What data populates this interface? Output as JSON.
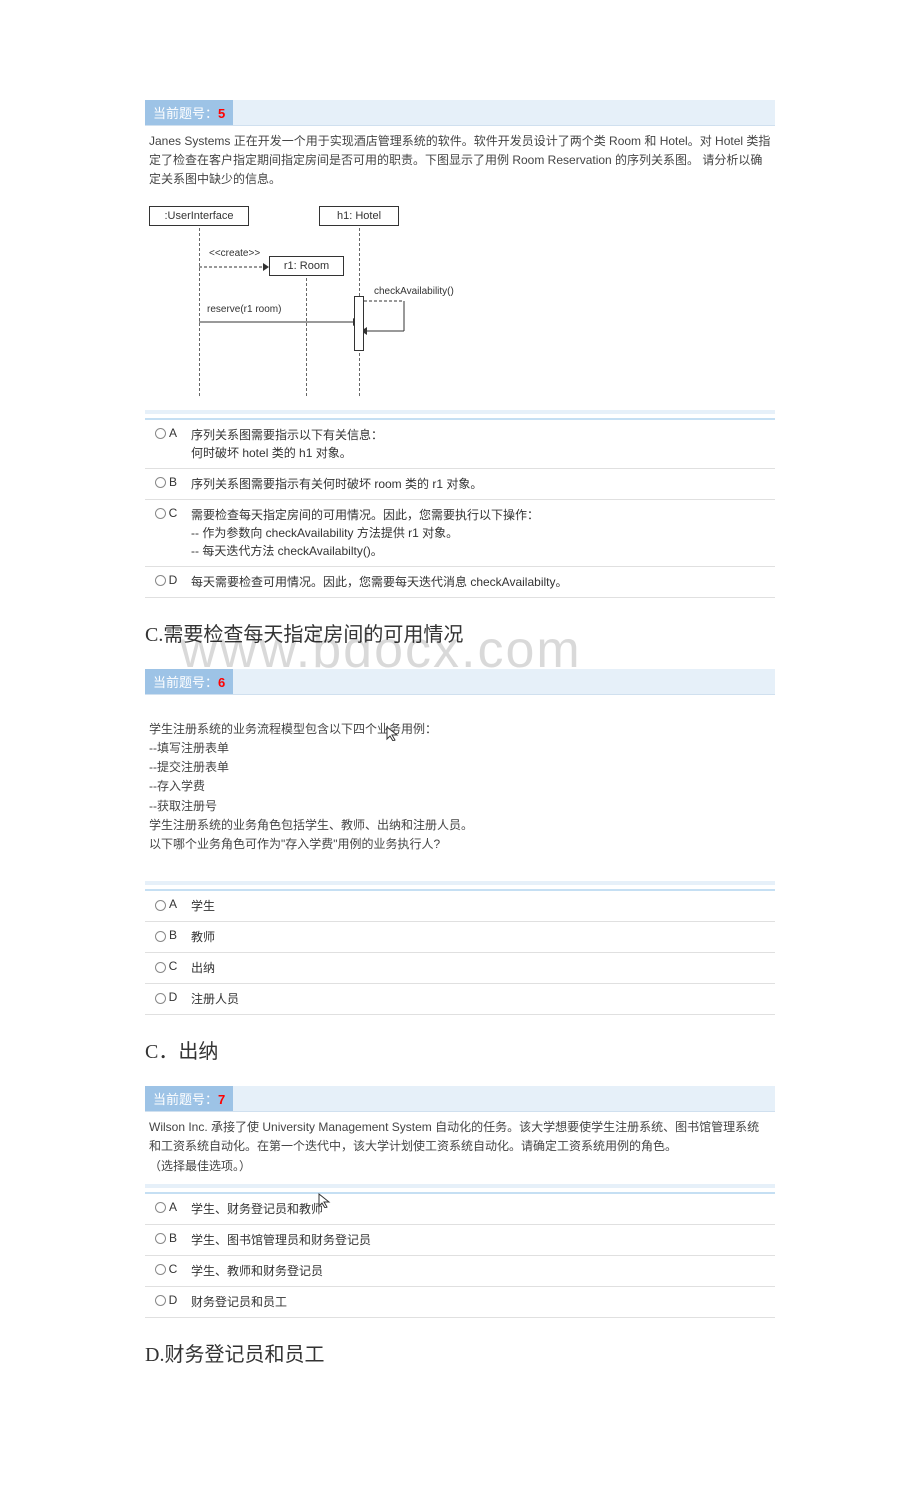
{
  "watermark": "www.bdocx.com",
  "q5": {
    "header_label": "当前题号：",
    "header_num": "5",
    "stem": "Janes Systems 正在开发一个用于实现酒店管理系统的软件。软件开发员设计了两个类 Room 和 Hotel。对 Hotel 类指定了检查在客户指定期间指定房间是否可用的职责。下图显示了用例 Room Reservation 的序列关系图。 请分析以确定关系图中缺少的信息。",
    "diagram": {
      "obj1": ":UserInterface",
      "obj2": "h1: Hotel",
      "obj3": "r1: Room",
      "msg_create": "<<create>>",
      "msg_reserve": "reserve(r1 room)",
      "msg_check": "checkAvailability()"
    },
    "options": {
      "A": "序列关系图需要指示以下有关信息：\n何时破坏 hotel 类的 h1 对象。",
      "B": "序列关系图需要指示有关何时破坏 room 类的 r1 对象。",
      "C": "需要检查每天指定房间的可用情况。因此，您需要执行以下操作：\n-- 作为参数向 checkAvailability 方法提供 r1 对象。\n-- 每天迭代方法 checkAvailabilty()。",
      "D": "每天需要检查可用情况。因此，您需要每天迭代消息 checkAvailabilty。"
    },
    "answer": "C.需要检查每天指定房间的可用情况"
  },
  "q6": {
    "header_label": "当前题号：",
    "header_num": "6",
    "stem": "学生注册系统的业务流程模型包含以下四个业务用例：\n--填写注册表单\n--提交注册表单\n--存入学费\n--获取注册号\n学生注册系统的业务角色包括学生、教师、出纳和注册人员。\n以下哪个业务角色可作为\"存入学费\"用例的业务执行人?",
    "options": {
      "A": "学生",
      "B": "教师",
      "C": "出纳",
      "D": "注册人员"
    },
    "answer": "C．出纳"
  },
  "q7": {
    "header_label": "当前题号：",
    "header_num": "7",
    "stem": "Wilson Inc. 承接了使 University Management System 自动化的任务。该大学想要使学生注册系统、图书馆管理系统和工资系统自动化。在第一个迭代中，该大学计划使工资系统自动化。请确定工资系统用例的角色。\n（选择最佳选项。）",
    "options": {
      "A": "学生、财务登记员和教师",
      "B": "学生、图书馆管理员和财务登记员",
      "C": "学生、教师和财务登记员",
      "D": "财务登记员和员工"
    },
    "answer": "D.财务登记员和员工"
  }
}
